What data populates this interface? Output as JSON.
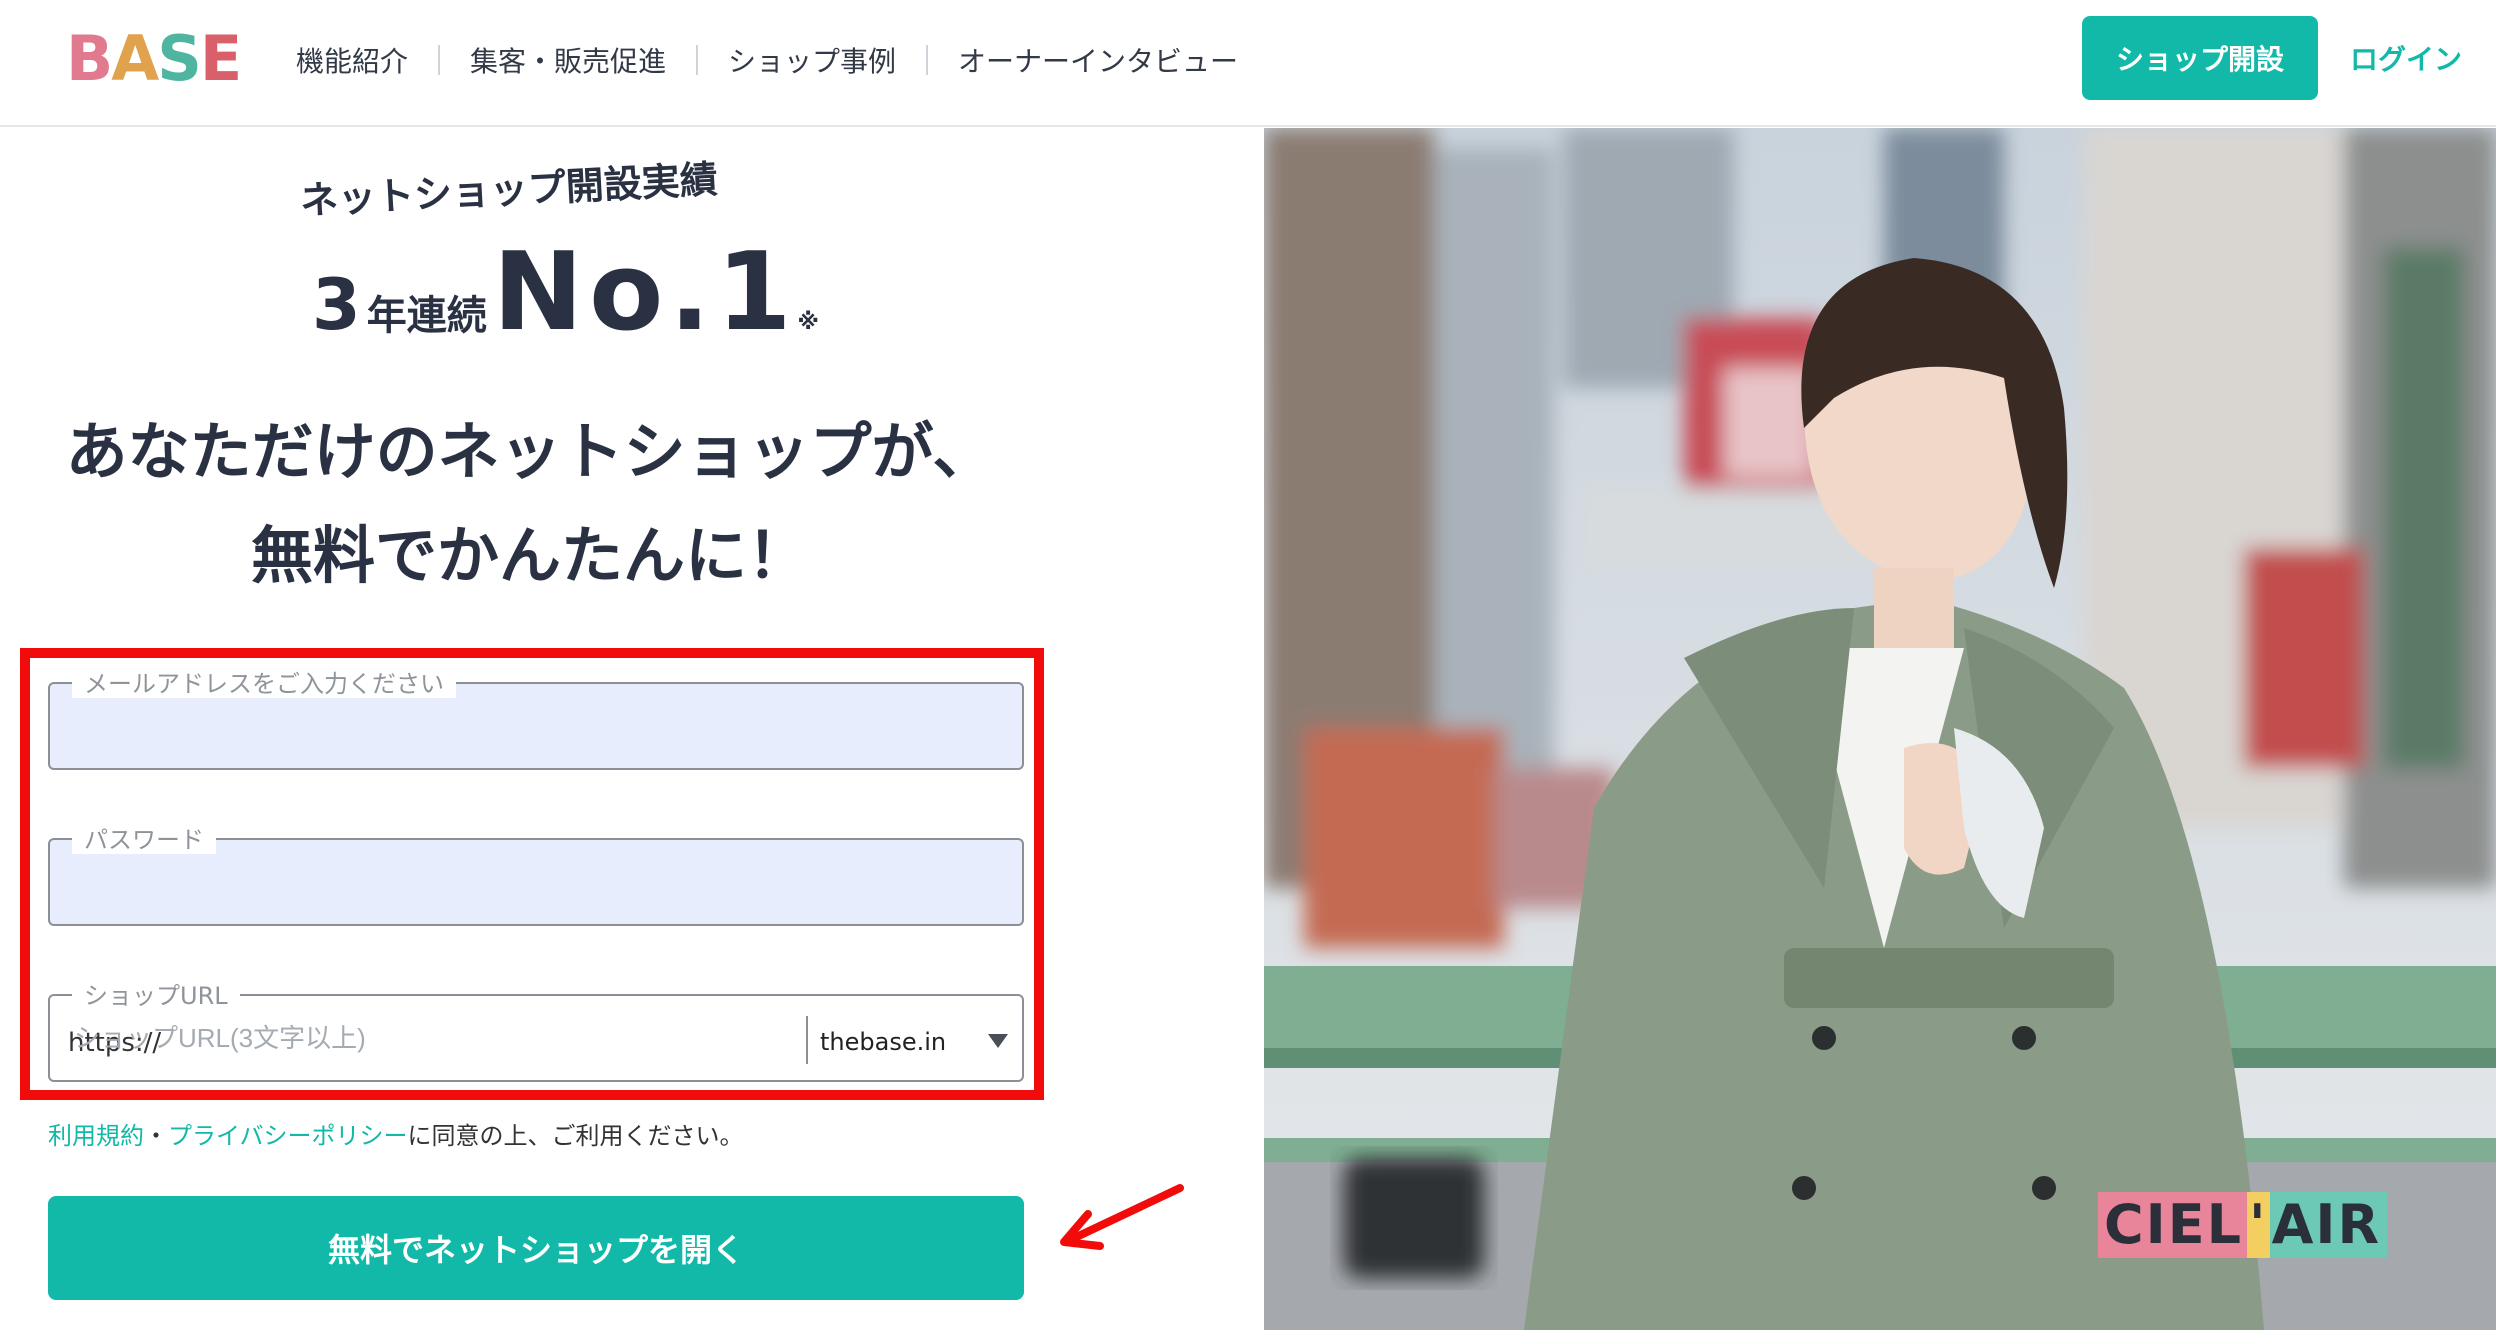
{
  "header": {
    "logo_text": [
      "B",
      "A",
      "S",
      "E"
    ],
    "nav": [
      "機能紹介",
      "集客・販売促進",
      "ショップ事例",
      "オーナーインタビュー"
    ],
    "open_shop_label": "ショップ開設",
    "login_label": "ログイン"
  },
  "hero": {
    "badge_title": "ネットショップ開設実績",
    "rank_num": "3",
    "rank_unit": "年連続",
    "rank_no": "No.1",
    "rank_note": "※",
    "headline_line1": "あなただけのネットショップが、",
    "headline_line2": "無料でかんたんに！"
  },
  "form": {
    "email_label": "メールアドレスをご入力ください",
    "email_value": "",
    "password_label": "パスワード",
    "password_value": "",
    "url_label": "ショップURL",
    "url_prefix": "https://",
    "url_placeholder": "ショップURL(3文字以上)",
    "url_domain": "thebase.in"
  },
  "terms": {
    "tos": "利用規約",
    "dot": "・",
    "privacy": "プライバシーポリシー",
    "suffix": "に同意の上、ご利用ください。"
  },
  "cta_label": "無料でネットショップを開く",
  "photo_brand": {
    "part1": "CIEL",
    "apostrophe": "'",
    "part2": "AIR"
  },
  "colors": {
    "accent": "#13b9a8",
    "highlight_box": "#f20b0b",
    "text": "#2a3142"
  }
}
